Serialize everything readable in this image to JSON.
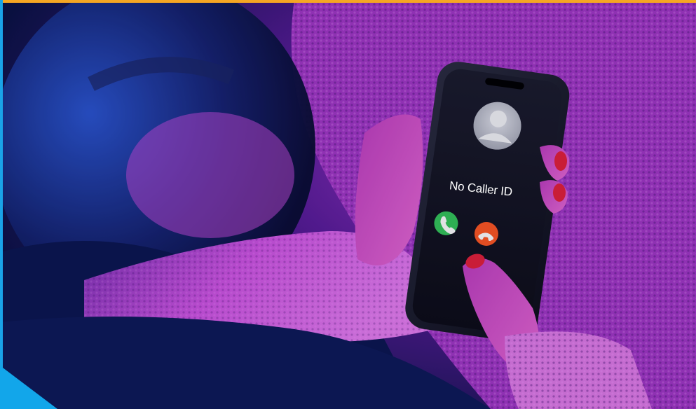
{
  "screen": {
    "caller_name": "No Caller ID"
  },
  "colors": {
    "top_bar": "#f5a623",
    "left_bar": "#1aa3e8",
    "corner_accent": "#12a6ea",
    "accept_button": "#34c759",
    "decline_button": "#ff5722",
    "ambient_magenta": "#c23bd6",
    "ambient_blue": "#1a3cc8"
  },
  "icons": {
    "avatar": "person-silhouette-icon",
    "accept": "phone-accept-icon",
    "decline": "phone-decline-icon"
  }
}
